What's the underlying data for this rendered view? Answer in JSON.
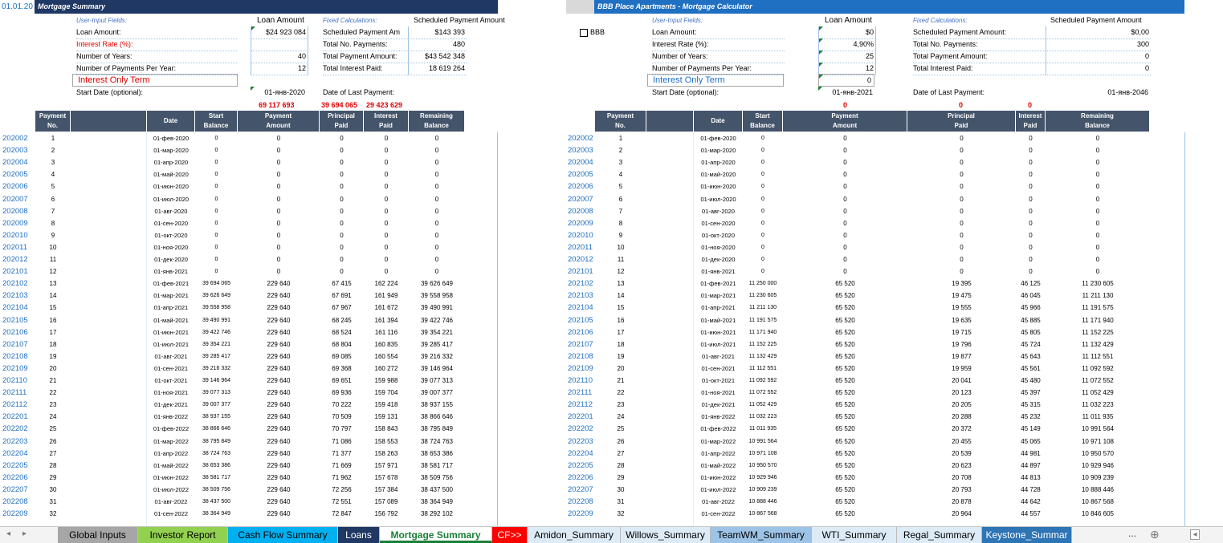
{
  "left": {
    "cell_ref": "01.01.20",
    "title": "Mortgage Summary",
    "user_input_label": "User-Input Fields:",
    "loan_amount_header": "Loan Amount",
    "fixed_calc_label": "Fixed Calculations:",
    "sched_payment_header": "Scheduled Payment Amount",
    "inputs": [
      {
        "label": "Loan Amount:",
        "value": "$24 923 084",
        "red": false
      },
      {
        "label": "Interest Rate (%):",
        "value": "",
        "red": true
      },
      {
        "label": "Number of Years:",
        "value": "40",
        "red": false
      },
      {
        "label": "Number of Payments Per Year:",
        "value": "12",
        "red": false
      }
    ],
    "interest_only_label": "Interest Only Term",
    "start_date_label": "Start Date (optional):",
    "start_date_value": "01-янв-2020",
    "calcs": [
      {
        "label": "Scheduled Payment Am",
        "value": "$143 393"
      },
      {
        "label": "Total No. Payments:",
        "value": "480"
      },
      {
        "label": "Total Payment Amount:",
        "value": "$43 542 348"
      },
      {
        "label": "Total Interest Paid:",
        "value": "18 619 264"
      }
    ],
    "last_payment_label": "Date of Last Payment:",
    "totals": [
      "69 117 693",
      "39 694 065",
      "29 423 629"
    ],
    "headers": [
      "Payment\nNo.",
      "Date",
      "Start\nBalance",
      "Payment\nAmount",
      "Principal\nPaid",
      "Interest\nPaid",
      "Remaining\nBalance"
    ],
    "rows": [
      [
        "202002",
        "1",
        "01-фев-2020",
        "0",
        "0",
        "0",
        "0",
        "0"
      ],
      [
        "202003",
        "2",
        "01-мар-2020",
        "0",
        "0",
        "0",
        "0",
        "0"
      ],
      [
        "202004",
        "3",
        "01-апр-2020",
        "0",
        "0",
        "0",
        "0",
        "0"
      ],
      [
        "202005",
        "4",
        "01-май-2020",
        "0",
        "0",
        "0",
        "0",
        "0"
      ],
      [
        "202006",
        "5",
        "01-июн-2020",
        "0",
        "0",
        "0",
        "0",
        "0"
      ],
      [
        "202007",
        "6",
        "01-июл-2020",
        "0",
        "0",
        "0",
        "0",
        "0"
      ],
      [
        "202008",
        "7",
        "01-авг-2020",
        "0",
        "0",
        "0",
        "0",
        "0"
      ],
      [
        "202009",
        "8",
        "01-сен-2020",
        "0",
        "0",
        "0",
        "0",
        "0"
      ],
      [
        "202010",
        "9",
        "01-окт-2020",
        "0",
        "0",
        "0",
        "0",
        "0"
      ],
      [
        "202011",
        "10",
        "01-ноя-2020",
        "0",
        "0",
        "0",
        "0",
        "0"
      ],
      [
        "202012",
        "11",
        "01-дек-2020",
        "0",
        "0",
        "0",
        "0",
        "0"
      ],
      [
        "202101",
        "12",
        "01-янв-2021",
        "0",
        "0",
        "0",
        "0",
        "0"
      ],
      [
        "202102",
        "13",
        "01-фев-2021",
        "39 694 065",
        "229 640",
        "67 415",
        "162 224",
        "39 626 649"
      ],
      [
        "202103",
        "14",
        "01-мар-2021",
        "39 626 649",
        "229 640",
        "67 691",
        "161 949",
        "39 558 958"
      ],
      [
        "202104",
        "15",
        "01-апр-2021",
        "39 558 958",
        "229 640",
        "67 967",
        "161 672",
        "39 490 991"
      ],
      [
        "202105",
        "16",
        "01-май-2021",
        "39 490 991",
        "229 640",
        "68 245",
        "161 394",
        "39 422 746"
      ],
      [
        "202106",
        "17",
        "01-июн-2021",
        "39 422 746",
        "229 640",
        "68 524",
        "161 116",
        "39 354 221"
      ],
      [
        "202107",
        "18",
        "01-июл-2021",
        "39 354 221",
        "229 640",
        "68 804",
        "160 835",
        "39 285 417"
      ],
      [
        "202108",
        "19",
        "01-авг-2021",
        "39 285 417",
        "229 640",
        "69 085",
        "160 554",
        "39 216 332"
      ],
      [
        "202109",
        "20",
        "01-сен-2021",
        "39 216 332",
        "229 640",
        "69 368",
        "160 272",
        "39 146 964"
      ],
      [
        "202110",
        "21",
        "01-окт-2021",
        "39 146 964",
        "229 640",
        "69 651",
        "159 988",
        "39 077 313"
      ],
      [
        "202111",
        "22",
        "01-ноя-2021",
        "39 077 313",
        "229 640",
        "69 936",
        "159 704",
        "39 007 377"
      ],
      [
        "202112",
        "23",
        "01-дек-2021",
        "39 007 377",
        "229 640",
        "70 222",
        "159 418",
        "38 937 155"
      ],
      [
        "202201",
        "24",
        "01-янв-2022",
        "38 937 155",
        "229 640",
        "70 509",
        "159 131",
        "38 866 646"
      ],
      [
        "202202",
        "25",
        "01-фев-2022",
        "38 866 646",
        "229 640",
        "70 797",
        "158 843",
        "38 795 849"
      ],
      [
        "202203",
        "26",
        "01-мар-2022",
        "38 795 849",
        "229 640",
        "71 086",
        "158 553",
        "38 724 763"
      ],
      [
        "202204",
        "27",
        "01-апр-2022",
        "38 724 763",
        "229 640",
        "71 377",
        "158 263",
        "38 653 386"
      ],
      [
        "202205",
        "28",
        "01-май-2022",
        "38 653 386",
        "229 640",
        "71 669",
        "157 971",
        "38 581 717"
      ],
      [
        "202206",
        "29",
        "01-июн-2022",
        "38 581 717",
        "229 640",
        "71 962",
        "157 678",
        "38 509 756"
      ],
      [
        "202207",
        "30",
        "01-июл-2022",
        "38 509 756",
        "229 640",
        "72 256",
        "157 384",
        "38 437 500"
      ],
      [
        "202208",
        "31",
        "01-авг-2022",
        "38 437 500",
        "229 640",
        "72 551",
        "157 089",
        "38 364 949"
      ],
      [
        "202209",
        "32",
        "01-сен-2022",
        "38 364 949",
        "229 640",
        "72 847",
        "156 792",
        "38 292 102"
      ]
    ]
  },
  "right": {
    "title": "BBB Place Apartments - Mortgage Calculator",
    "checkbox_label": "BBB",
    "user_input_label": "User-Input Fields:",
    "loan_amount_header": "Loan Amount",
    "fixed_calc_label": "Fixed Calculations:",
    "sched_payment_header": "Scheduled Payment Amount",
    "inputs": [
      {
        "label": "Loan Amount:",
        "value": "$0"
      },
      {
        "label": "Interest Rate (%):",
        "value": "4,90%"
      },
      {
        "label": "Number of Years:",
        "value": "25"
      },
      {
        "label": "Number of Payments Per Year:",
        "value": "12"
      }
    ],
    "interest_only_label": "Interest Only Term",
    "interest_only_value": "0",
    "start_date_label": "Start Date (optional):",
    "start_date_value": "01-янв-2021",
    "calcs": [
      {
        "label": "Scheduled Payment Amount:",
        "value": "$0,00"
      },
      {
        "label": "Total No. Payments:",
        "value": "300"
      },
      {
        "label": "Total Payment Amount:",
        "value": "0"
      },
      {
        "label": "Total Interest Paid:",
        "value": "0"
      }
    ],
    "last_payment_label": "Date of Last Payment:",
    "last_payment_value": "01-янв-2046",
    "totals": [
      "0",
      "0",
      "0"
    ],
    "headers": [
      "Payment\nNo.",
      "Date",
      "Start\nBalance",
      "Payment\nAmount",
      "Principal\nPaid",
      "Interest\nPaid",
      "Remaining\nBalance"
    ],
    "rows": [
      [
        "202002",
        "1",
        "01-фев-2020",
        "0",
        "0",
        "0",
        "0",
        "0"
      ],
      [
        "202003",
        "2",
        "01-мар-2020",
        "0",
        "0",
        "0",
        "0",
        "0"
      ],
      [
        "202004",
        "3",
        "01-апр-2020",
        "0",
        "0",
        "0",
        "0",
        "0"
      ],
      [
        "202005",
        "4",
        "01-май-2020",
        "0",
        "0",
        "0",
        "0",
        "0"
      ],
      [
        "202006",
        "5",
        "01-июн-2020",
        "0",
        "0",
        "0",
        "0",
        "0"
      ],
      [
        "202007",
        "6",
        "01-июл-2020",
        "0",
        "0",
        "0",
        "0",
        "0"
      ],
      [
        "202008",
        "7",
        "01-авг-2020",
        "0",
        "0",
        "0",
        "0",
        "0"
      ],
      [
        "202009",
        "8",
        "01-сен-2020",
        "0",
        "0",
        "0",
        "0",
        "0"
      ],
      [
        "202010",
        "9",
        "01-окт-2020",
        "0",
        "0",
        "0",
        "0",
        "0"
      ],
      [
        "202011",
        "10",
        "01-ноя-2020",
        "0",
        "0",
        "0",
        "0",
        "0"
      ],
      [
        "202012",
        "11",
        "01-дек-2020",
        "0",
        "0",
        "0",
        "0",
        "0"
      ],
      [
        "202101",
        "12",
        "01-янв-2021",
        "0",
        "0",
        "0",
        "0",
        "0"
      ],
      [
        "202102",
        "13",
        "01-фев-2021",
        "11 250 000",
        "65 520",
        "19 395",
        "46 125",
        "11 230 605"
      ],
      [
        "202103",
        "14",
        "01-мар-2021",
        "11 230 605",
        "65 520",
        "19 475",
        "46 045",
        "11 211 130"
      ],
      [
        "202104",
        "15",
        "01-апр-2021",
        "11 211 130",
        "65 520",
        "19 555",
        "45 966",
        "11 191 575"
      ],
      [
        "202105",
        "16",
        "01-май-2021",
        "11 191 575",
        "65 520",
        "19 635",
        "45 885",
        "11 171 940"
      ],
      [
        "202106",
        "17",
        "01-июн-2021",
        "11 171 940",
        "65 520",
        "19 715",
        "45 805",
        "11 152 225"
      ],
      [
        "202107",
        "18",
        "01-июл-2021",
        "11 152 225",
        "65 520",
        "19 796",
        "45 724",
        "11 132 429"
      ],
      [
        "202108",
        "19",
        "01-авг-2021",
        "11 132 429",
        "65 520",
        "19 877",
        "45 643",
        "11 112 551"
      ],
      [
        "202109",
        "20",
        "01-сен-2021",
        "11 112 551",
        "65 520",
        "19 959",
        "45 561",
        "11 092 592"
      ],
      [
        "202110",
        "21",
        "01-окт-2021",
        "11 092 592",
        "65 520",
        "20 041",
        "45 480",
        "11 072 552"
      ],
      [
        "202111",
        "22",
        "01-ноя-2021",
        "11 072 552",
        "65 520",
        "20 123",
        "45 397",
        "11 052 429"
      ],
      [
        "202112",
        "23",
        "01-дек-2021",
        "11 052 429",
        "65 520",
        "20 205",
        "45 315",
        "11 032 223"
      ],
      [
        "202201",
        "24",
        "01-янв-2022",
        "11 032 223",
        "65 520",
        "20 288",
        "45 232",
        "11 011 935"
      ],
      [
        "202202",
        "25",
        "01-фев-2022",
        "11 011 935",
        "65 520",
        "20 372",
        "45 149",
        "10 991 564"
      ],
      [
        "202203",
        "26",
        "01-мар-2022",
        "10 991 564",
        "65 520",
        "20 455",
        "45 065",
        "10 971 108"
      ],
      [
        "202204",
        "27",
        "01-апр-2022",
        "10 971 108",
        "65 520",
        "20 539",
        "44 981",
        "10 950 570"
      ],
      [
        "202205",
        "28",
        "01-май-2022",
        "10 950 570",
        "65 520",
        "20 623",
        "44 897",
        "10 929 946"
      ],
      [
        "202206",
        "29",
        "01-июн-2022",
        "10 929 946",
        "65 520",
        "20 708",
        "44 813",
        "10 909 239"
      ],
      [
        "202207",
        "30",
        "01-июл-2022",
        "10 909 239",
        "65 520",
        "20 793",
        "44 728",
        "10 888 446"
      ],
      [
        "202208",
        "31",
        "01-авг-2022",
        "10 888 446",
        "65 520",
        "20 878",
        "44 642",
        "10 867 568"
      ],
      [
        "202209",
        "32",
        "01-сен-2022",
        "10 867 568",
        "65 520",
        "20 964",
        "44 557",
        "10 846 605"
      ]
    ]
  },
  "tabs": [
    {
      "label": "Global Inputs",
      "bg": "#a6a6a6",
      "fg": "#000000",
      "active": false
    },
    {
      "label": "Investor Report",
      "bg": "#92d050",
      "fg": "#000000",
      "active": false
    },
    {
      "label": "Cash Flow Summary",
      "bg": "#00b0f0",
      "fg": "#000000",
      "active": false
    },
    {
      "label": "Loans",
      "bg": "#1f3864",
      "fg": "#ffffff",
      "active": false
    },
    {
      "label": "Mortgage Summary",
      "bg": "#ffffff",
      "fg": "#1a7f37",
      "active": true
    },
    {
      "label": "CF>>",
      "bg": "#ff0000",
      "fg": "#ffffff",
      "active": false
    },
    {
      "label": "Amidon_Summary",
      "bg": "#ddebf7",
      "fg": "#000000",
      "active": false
    },
    {
      "label": "Willows_Summary",
      "bg": "#ddebf7",
      "fg": "#000000",
      "active": false
    },
    {
      "label": "TeamWM_Summary",
      "bg": "#9dc3e6",
      "fg": "#000000",
      "active": false
    },
    {
      "label": "WTI_Summary",
      "bg": "#ddebf7",
      "fg": "#000000",
      "active": false
    },
    {
      "label": "Regal_Summary",
      "bg": "#ddebf7",
      "fg": "#000000",
      "active": false
    },
    {
      "label": "Keystone_Summar",
      "bg": "#2e75b6",
      "fg": "#ffffff",
      "active": false
    }
  ],
  "tab_more": "...",
  "colors": {
    "header": "#44546a",
    "title_dark": "#1f3864",
    "title_blue": "#1f6fc2",
    "row_link": "#1f6fc2",
    "total_red": "#e00000"
  }
}
